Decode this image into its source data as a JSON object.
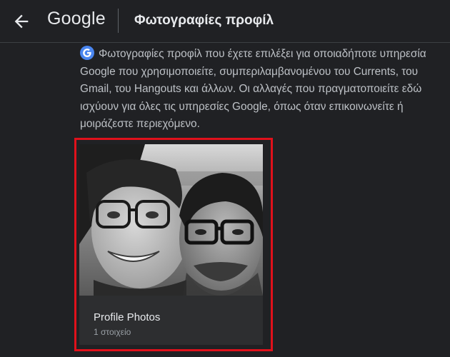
{
  "header": {
    "brand": "Google",
    "title": "Φωτογραφίες προφίλ",
    "back_icon": "arrow-back-icon"
  },
  "description": {
    "badge_icon": "google-g-icon",
    "text": "Φωτογραφίες προφίλ που έχετε επιλέξει για οποιαδήποτε υπηρεσία Google που χρησιμοποιείτε, συμπεριλαμβανομένου του Currents, του Gmail, του Hangouts και άλλων. Οι αλλαγές που πραγματοποιείτε εδώ ισχύουν για όλες τις υπηρεσίες Google, όπως όταν επικοινωνείτε ή μοιράζεστε περιεχόμενο."
  },
  "album": {
    "title": "Profile Photos",
    "count": "1 στοιχείο"
  },
  "colors": {
    "background": "#202124",
    "card": "#303134",
    "highlight": "#e0111b",
    "google_blue": "#4285f4"
  }
}
